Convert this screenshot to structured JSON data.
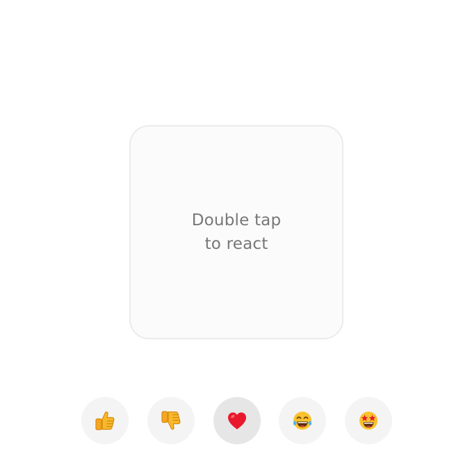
{
  "card": {
    "prompt_line1": "Double tap",
    "prompt_line2": "to react"
  },
  "reactions": [
    {
      "icon": "thumbs-up-icon",
      "color": "#f8b82a"
    },
    {
      "icon": "thumbs-down-icon",
      "color": "#f8b82a"
    },
    {
      "icon": "red-heart-icon",
      "color": "#e8192c",
      "selected": true
    },
    {
      "icon": "tears-of-joy-icon",
      "color": "#f9c22e"
    },
    {
      "icon": "star-struck-icon",
      "color": "#f9c22e"
    }
  ],
  "colors": {
    "card_border": "#ebebeb",
    "card_background": "#fbfbfb",
    "prompt_text": "#777777",
    "button_background": "#f4f4f4",
    "button_selected_background": "#e6e6e6"
  }
}
